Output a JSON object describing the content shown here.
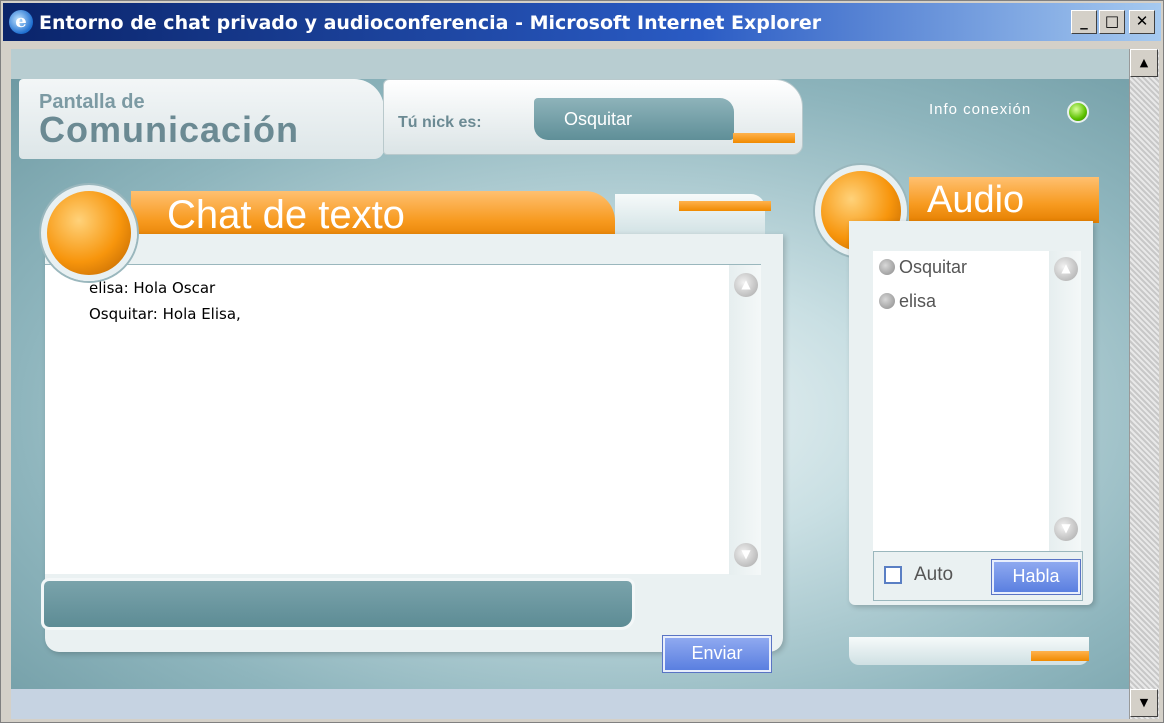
{
  "window": {
    "title": "Entorno de chat privado y audioconferencia - Microsoft Internet Explorer",
    "minimize": "_",
    "maximize": "□",
    "close": "✕"
  },
  "app": {
    "logo_small": "Pantalla de",
    "logo_big": "Comunicación",
    "nick_label": "Tú nick es:",
    "nick_value": "Osquitar",
    "info_label": "Info conexión",
    "connection_led_color": "#5cc000"
  },
  "chat": {
    "title": "Chat de texto",
    "messages": [
      "elisa: Hola Oscar",
      "Osquitar: Hola Elisa,"
    ],
    "input_value": "",
    "send_label": "Enviar"
  },
  "audio": {
    "title": "Audio",
    "users": [
      "Osquitar",
      "elisa"
    ],
    "auto_label": "Auto",
    "auto_checked": false,
    "talk_label": "Habla"
  },
  "colors": {
    "accent_orange": "#f79a1f",
    "button_blue": "#5a7fe0",
    "panel_teal": "#7fa6ad"
  }
}
